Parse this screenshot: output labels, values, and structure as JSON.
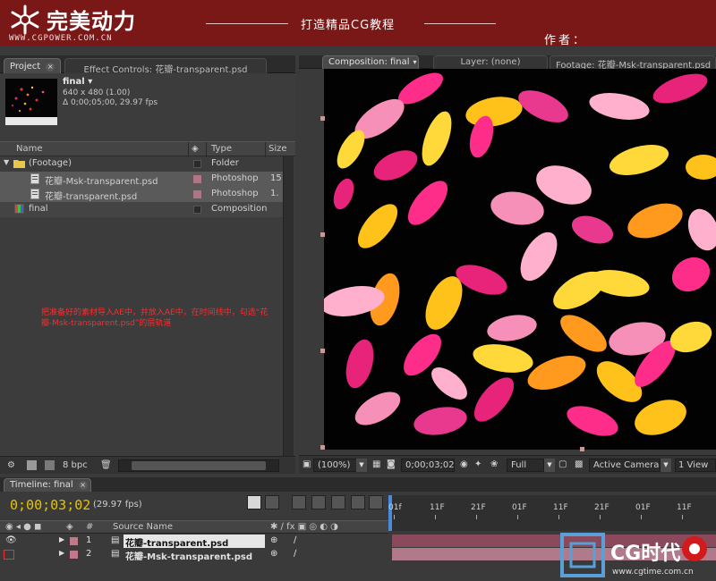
{
  "banner": {
    "brand_name": "完美动力",
    "url": "WWW.CGPOWER.COM.CN",
    "slogan": "打造精品CG教程",
    "author": "作者："
  },
  "project_panel": {
    "tabs": [
      {
        "label": "Project",
        "active": true
      },
      {
        "label": "Effect Controls: 花瓣-transparent.psd",
        "active": false
      }
    ],
    "asset": {
      "name": "final",
      "dimensions": "640 x 480 (1.00)",
      "duration": "Δ 0;00;05;00, 29.97 fps"
    },
    "columns": [
      "Name",
      "Type",
      "Size"
    ],
    "items": [
      {
        "name": "(Footage)",
        "type": "Folder",
        "size": "",
        "kind": "folder",
        "label_color": "#2a2a2a"
      },
      {
        "name": "花瓣-Msk-transparent.psd",
        "type": "Photoshop",
        "size": "15",
        "kind": "psd",
        "label_color": "#b07585"
      },
      {
        "name": "花瓣-transparent.psd",
        "type": "Photoshop",
        "size": "1.",
        "kind": "psd",
        "label_color": "#b07585"
      },
      {
        "name": "final",
        "type": "Composition",
        "size": "",
        "kind": "comp",
        "label_color": "#2a2a2a"
      }
    ],
    "note": "把准备好的素材导入AE中，并放入AE中，在时间线中，勾选“花瓣-Msk-transparent.psd”的层轨道",
    "bit_depth": "8 bpc"
  },
  "comp_panel": {
    "tabs": [
      {
        "label": "Composition: final",
        "active": true
      },
      {
        "label": "Layer: (none)",
        "active": false
      },
      {
        "label": "Footage: 花瓣-Msk-transparent.psd",
        "active": false
      }
    ],
    "zoom": "(100%)",
    "timecode": "0;00;03;02",
    "resolution": "Full",
    "camera": "Active Camera",
    "view": "1 View"
  },
  "timeline": {
    "tab_label": "Timeline: final",
    "timecode": "0;00;03;02",
    "fps": "(29.97 fps)",
    "column_source": "Source Name",
    "column_index": "#",
    "ruler_labels": [
      "01f",
      "11F",
      "21F",
      "01F",
      "11F",
      "21F",
      "01F",
      "11F"
    ],
    "layers": [
      {
        "index": "1",
        "name": "花瓣-transparent.psd",
        "color": "#c0788a"
      },
      {
        "index": "2",
        "name": "花瓣-Msk-transparent.psd",
        "color": "#c0788a"
      }
    ]
  },
  "watermark": {
    "text": "CG时代",
    "url": "www.cgtime.com.cn"
  },
  "colors": {
    "banner": "#7a1717",
    "timecode": "#e6c300",
    "note": "#ff2a2a",
    "layer_bar": "#8a4a5c"
  }
}
